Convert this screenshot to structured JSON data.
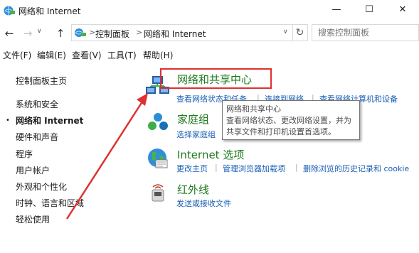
{
  "window": {
    "title": "网络和 Internet",
    "minimize_symbol": "—",
    "maximize_symbol": "☐",
    "close_symbol": "✕"
  },
  "nav": {
    "back_symbol": "←",
    "forward_symbol": "→",
    "recent_symbol": "∨",
    "up_symbol": "↑",
    "address_segments": [
      "控制面板",
      "网络和 Internet"
    ],
    "address_separator": ">",
    "address_dropdown_symbol": "∨",
    "refresh_symbol": "↻",
    "search_placeholder": "搜索控制面板"
  },
  "menu": [
    "文件(F)",
    "编辑(E)",
    "查看(V)",
    "工具(T)",
    "帮助(H)"
  ],
  "sidebar": {
    "home": "控制面板主页",
    "items": [
      "系统和安全",
      "网络和 Internet",
      "硬件和声音",
      "程序",
      "用户帐户",
      "外观和个性化",
      "时钟、语言和区域",
      "轻松使用"
    ],
    "active_index": 1,
    "active_bullet": "•"
  },
  "categories": [
    {
      "title": "网络和共享中心",
      "icon": "network-sharing-icon",
      "links": [
        "查看网络状态和任务",
        "连接到网络",
        "查看网络计算机和设备"
      ]
    },
    {
      "title": "家庭组",
      "icon": "homegroup-icon",
      "links": [
        "选择家庭组"
      ]
    },
    {
      "title": "Internet 选项",
      "icon": "internet-globe-icon",
      "links": [
        "更改主页",
        "管理浏览器加载项",
        "删除浏览的历史记录和 cookie"
      ]
    },
    {
      "title": "红外线",
      "icon": "infrared-icon",
      "links": [
        "发送或接收文件"
      ]
    }
  ],
  "link_separator": "|",
  "tooltip": {
    "lines": [
      "网络和共享中心",
      "查看网络状态、更改网络设置，并为",
      "共享文件和打印机设置首选项。"
    ]
  },
  "colors": {
    "title_green": "#1e7b1e",
    "link_blue": "#1a5fb4",
    "annotation_red": "#e03030"
  }
}
